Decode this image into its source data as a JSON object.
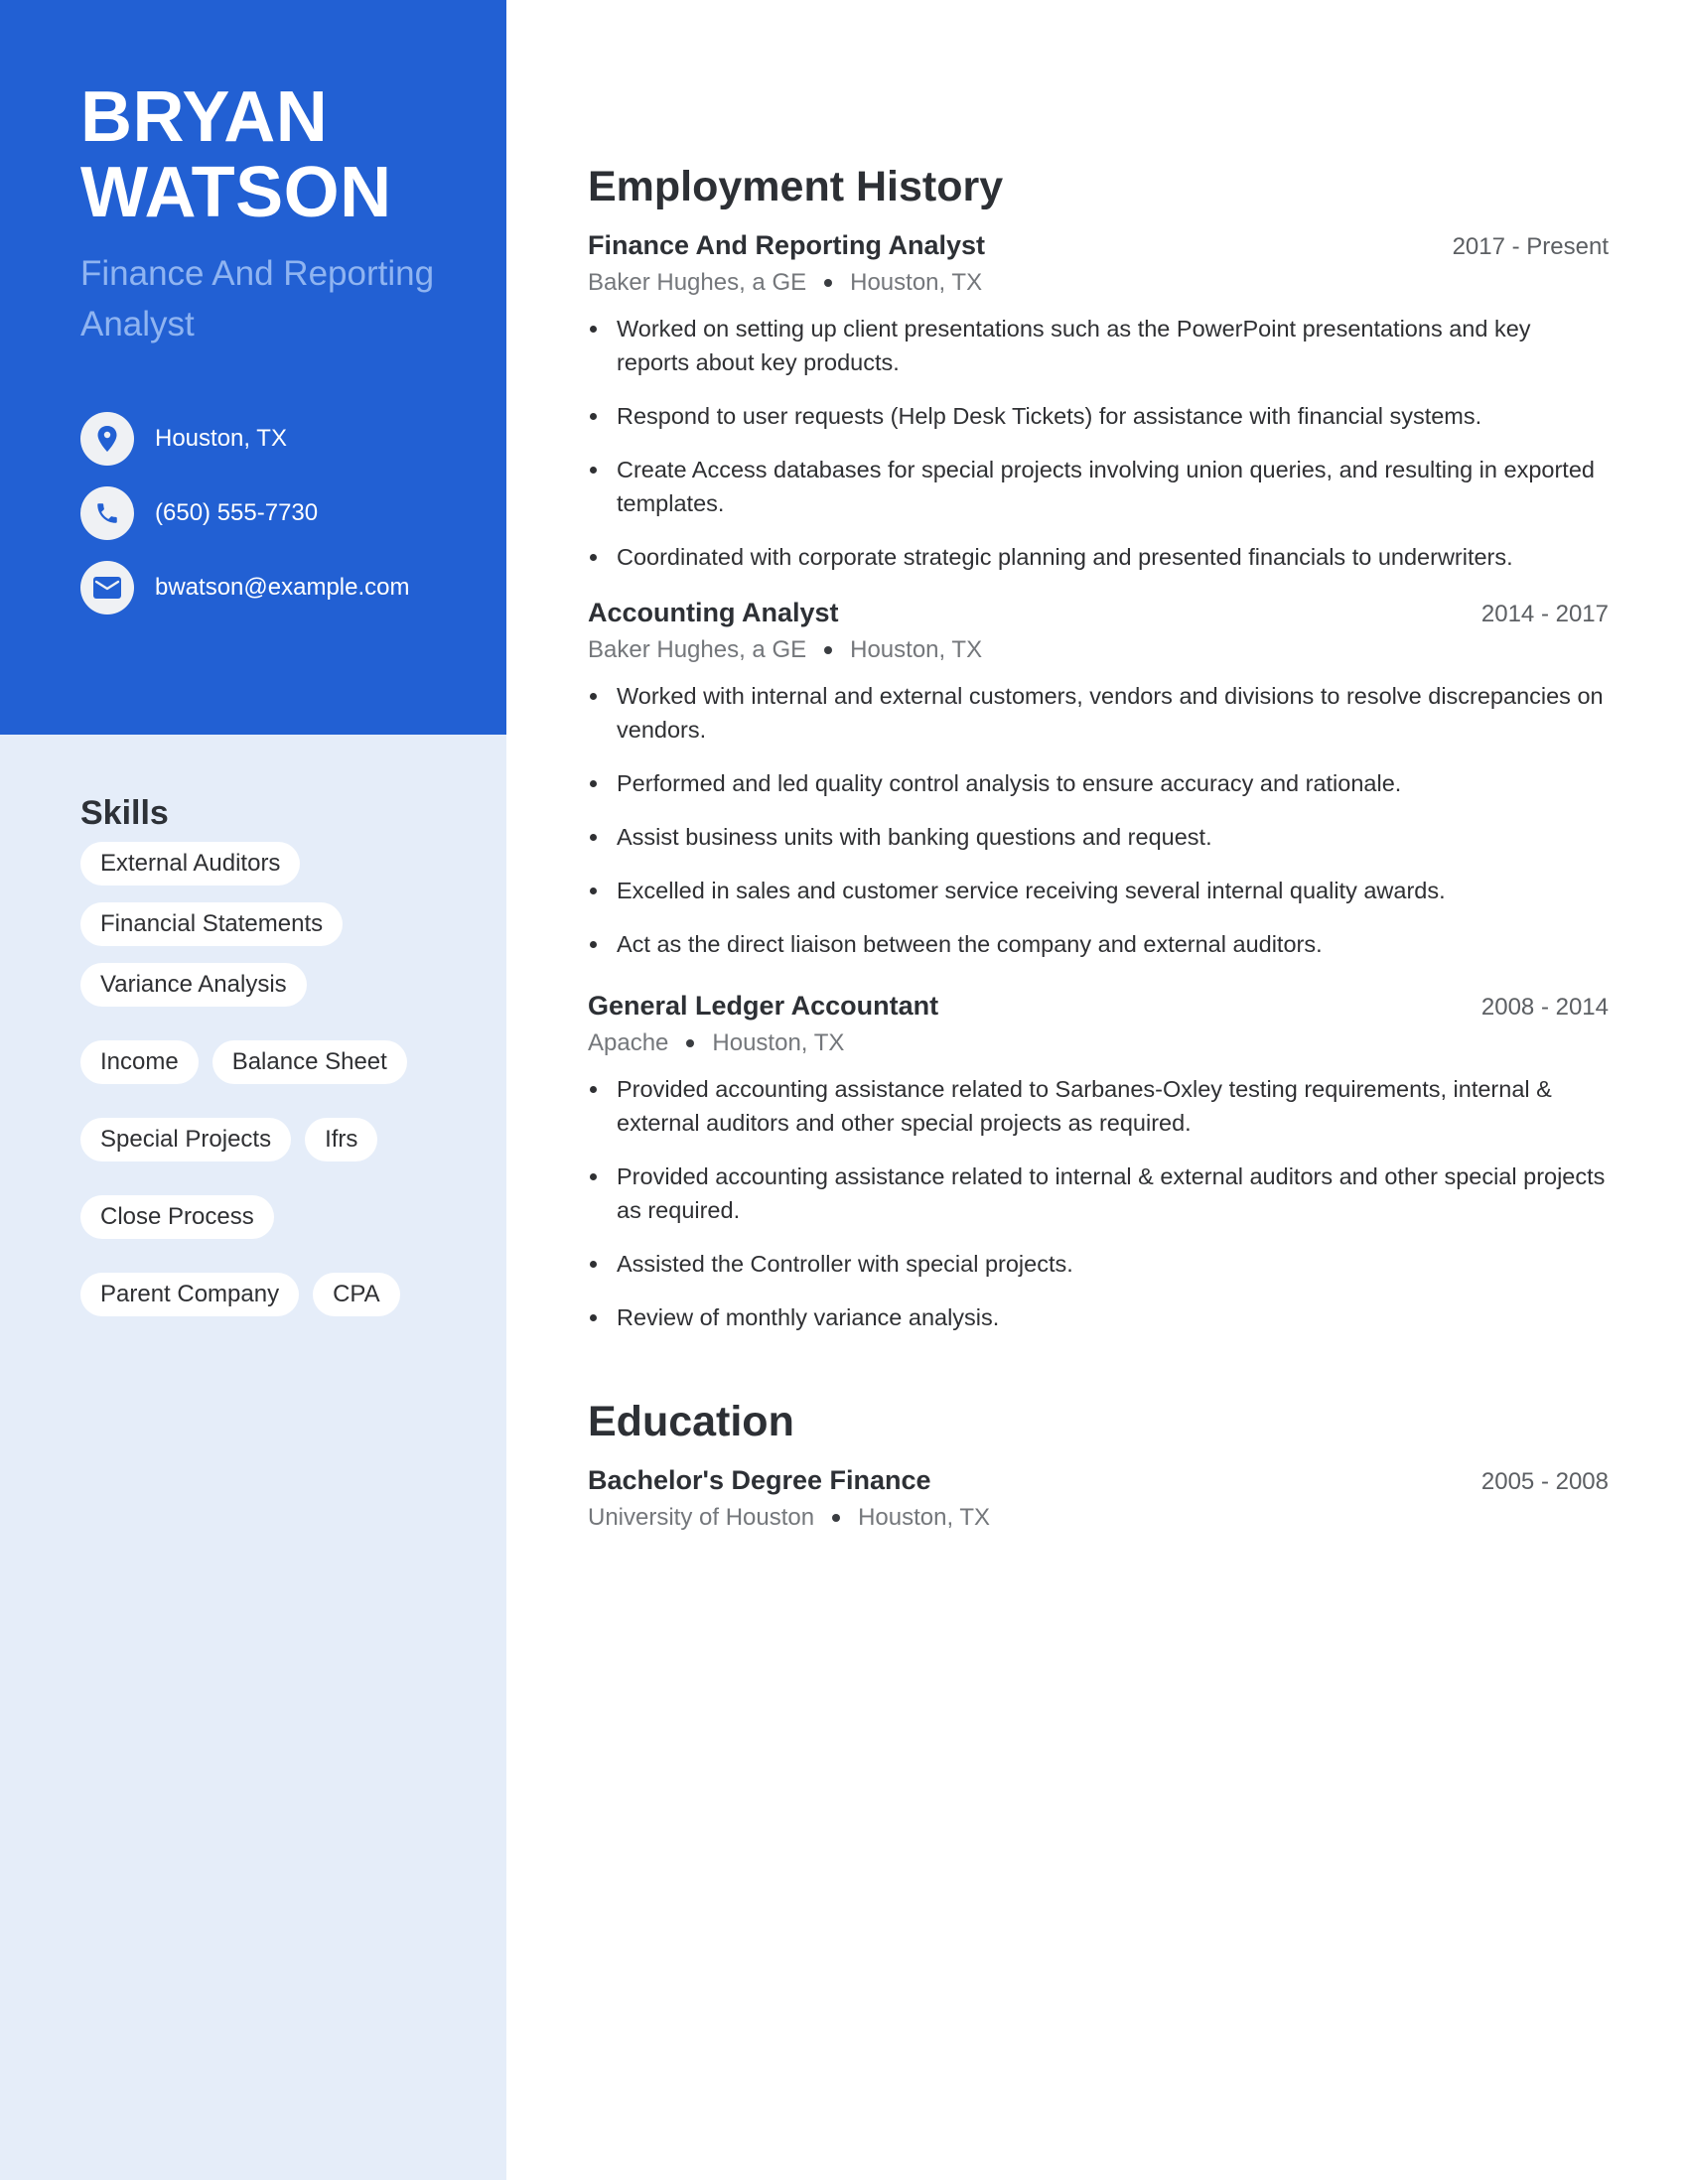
{
  "profile": {
    "first_name": "BRYAN",
    "last_name": "WATSON",
    "job_title": "Finance And Reporting Analyst"
  },
  "contacts": {
    "location": {
      "icon": "location-pin-icon",
      "text": "Houston, TX"
    },
    "phone": {
      "icon": "phone-icon",
      "text": "(650) 555-7730"
    },
    "email": {
      "icon": "mail-icon",
      "text": "bwatson@example.com"
    }
  },
  "skills": {
    "title": "Skills",
    "items": [
      "External Auditors",
      "Financial Statements",
      "Variance Analysis",
      "Income",
      "Balance Sheet",
      "Special Projects",
      "Ifrs",
      "Close Process",
      "Parent Company",
      "CPA"
    ]
  },
  "employment": {
    "title": "Employment History",
    "jobs": [
      {
        "role": "Finance And Reporting Analyst",
        "dates": "2017 - Present",
        "company": "Baker Hughes, a GE",
        "location": "Houston, TX",
        "bullets": [
          "Worked on setting up client presentations such as the PowerPoint presentations and key reports about key products.",
          "Respond to user requests (Help Desk Tickets) for assistance with financial systems.",
          "Create Access databases for special projects involving union queries, and resulting in exported templates.",
          "Coordinated with corporate strategic planning and presented financials to underwriters."
        ]
      },
      {
        "role": "Accounting Analyst",
        "dates": "2014 - 2017",
        "company": "Baker Hughes, a GE",
        "location": "Houston, TX",
        "bullets": [
          "Worked with internal and external customers, vendors and divisions to resolve discrepancies on vendors.",
          "Performed and led quality control analysis to ensure accuracy and rationale.",
          "Assist business units with banking questions and request.",
          "Excelled in sales and customer service receiving several internal quality awards.",
          "Act as the direct liaison between the company and external auditors."
        ]
      },
      {
        "role": "General Ledger Accountant",
        "dates": "2008 - 2014",
        "company": "Apache",
        "location": "Houston, TX",
        "bullets": [
          "Provided accounting assistance related to Sarbanes-Oxley testing requirements, internal & external auditors and other special projects as required.",
          "Provided accounting assistance related to internal & external auditors and other special projects as required.",
          "Assisted the Controller with special projects.",
          "Review of monthly variance analysis."
        ]
      }
    ]
  },
  "education": {
    "title": "Education",
    "items": [
      {
        "degree": "Bachelor's Degree Finance",
        "dates": "2005 - 2008",
        "school": "University of Houston",
        "location": "Houston, TX"
      }
    ]
  },
  "colors": {
    "accent": "#2260d3",
    "sidebar_light": "#e5edf9",
    "subtitle": "#8fb4f1"
  }
}
